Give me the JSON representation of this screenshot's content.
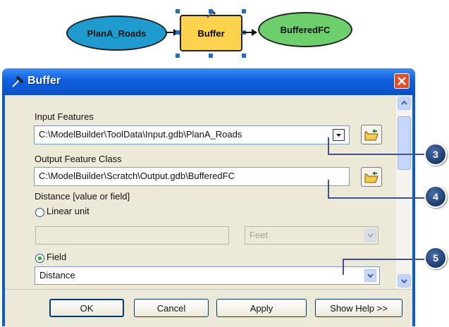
{
  "model": {
    "input_node": "PlanA_Roads",
    "tool_node": "Buffer",
    "output_node": "BufferedFC"
  },
  "dialog": {
    "title": "Buffer",
    "tool_icon": "hammer-icon",
    "input_features": {
      "label": "Input Features",
      "value": "C:\\ModelBuilder\\ToolData\\Input.gdb\\PlanA_Roads"
    },
    "output_feature_class": {
      "label": "Output Feature Class",
      "value": "C:\\ModelBuilder\\Scratch\\Output.gdb\\BufferedFC"
    },
    "distance": {
      "label": "Distance [value or field]",
      "linear_unit_label": "Linear unit",
      "linear_unit_value": "",
      "unit_option": "Feet",
      "field_label": "Field",
      "field_value": "Distance",
      "selected": "Field"
    },
    "buttons": {
      "ok": "OK",
      "cancel": "Cancel",
      "apply": "Apply",
      "show_help": "Show Help >>"
    }
  },
  "callouts": [
    "3",
    "4",
    "5"
  ],
  "colors": {
    "input_node": "#1f9bd0",
    "tool_node": "#fdd24c",
    "output_node": "#6ccf6c",
    "title_bar": "#0a5ad8",
    "callout": "#1c3a6e"
  }
}
